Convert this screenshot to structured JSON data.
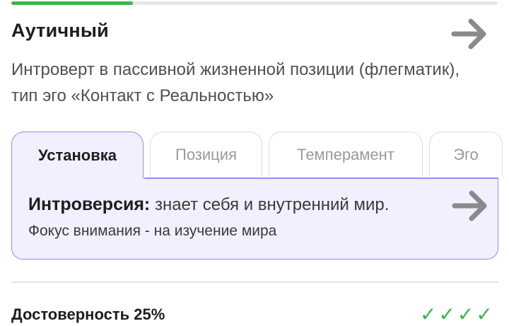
{
  "progress": {
    "value_percent": 25,
    "fill_color": "#3bb54a",
    "track_color": "#e6e8ea"
  },
  "header": {
    "title": "Аутичный",
    "description": "Интроверт в пассивной жизненной позиции (флегматик), тип эго «Контакт с Реальностью»",
    "arrow_icon": "arrow-right-icon"
  },
  "tabs": [
    {
      "label": "Установка",
      "active": true
    },
    {
      "label": "Позиция",
      "active": false
    },
    {
      "label": "Темперамент",
      "active": false
    },
    {
      "label": "Эго",
      "active": false
    }
  ],
  "panel": {
    "term": "Интроверсия:",
    "text": "знает себя и внутренний мир.",
    "subtext": "Фокус внимания - на изучение мира",
    "arrow_icon": "arrow-right-icon",
    "accent_color": "#9b8ce6",
    "background": "#f2efff"
  },
  "footer": {
    "reliability_label": "Достоверность 25%",
    "checks": "✓✓✓✓",
    "checks_color": "#3bb54a"
  }
}
